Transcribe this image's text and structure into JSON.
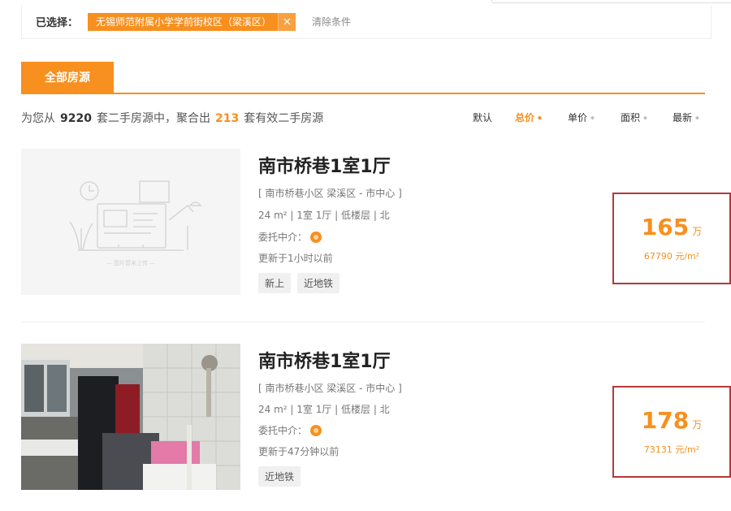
{
  "filter": {
    "label": "已选择：",
    "tag_text": "无锡师范附属小学学前街校区（梁溪区）",
    "tag_close": "×",
    "clear": "清除条件"
  },
  "tab": {
    "label": "全部房源"
  },
  "summary": {
    "prefix": "为您从",
    "total": "9220",
    "mid": "套二手房源中，聚合出",
    "valid": "213",
    "suffix": "套有效二手房源"
  },
  "sort": {
    "default": "默认",
    "total_price": "总价",
    "unit_price": "单价",
    "area": "面积",
    "newest": "最新",
    "arrow": "⬥"
  },
  "listings": [
    {
      "title": "南市桥巷1室1厅",
      "location": "[ 南市桥巷小区 梁溪区 - 市中心 ]",
      "specs": "24 m² | 1室 1厅 | 低楼层 | 北",
      "agent": "委托中介：",
      "updated": "更新于1小时以前",
      "tags": [
        "新上",
        "近地铁"
      ],
      "price": "165",
      "price_unit": "万",
      "unit_price": "67790 元/m²",
      "placeholder_caption": "— 图片暂未上传 —"
    },
    {
      "title": "南市桥巷1室1厅",
      "location": "[ 南市桥巷小区 梁溪区 - 市中心 ]",
      "specs": "24 m² | 1室 1厅 | 低楼层 | 北",
      "agent": "委托中介：",
      "updated": "更新于47分钟以前",
      "tags": [
        "近地铁"
      ],
      "price": "178",
      "price_unit": "万",
      "unit_price": "73131 元/m²"
    }
  ],
  "colors": {
    "accent": "#f7901e",
    "highlight_box": "#b5383a"
  },
  "icons": {
    "close": "close-icon",
    "agent": "agent-icon",
    "sort": "sort-arrow-icon"
  }
}
